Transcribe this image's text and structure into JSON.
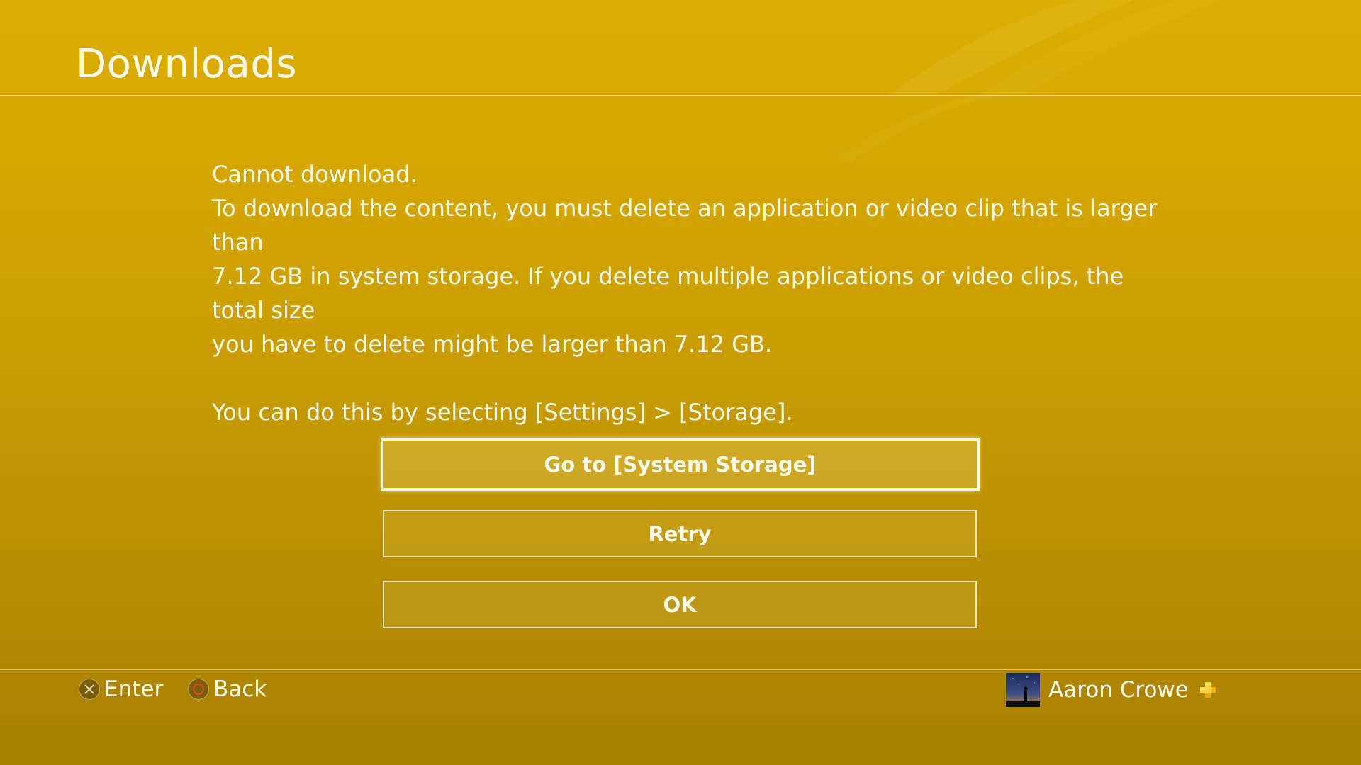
{
  "header": {
    "title": "Downloads"
  },
  "message": {
    "lines": [
      "Cannot download.",
      "To download the content, you must delete an application or video clip that is larger than",
      "7.12 GB in system storage. If you delete multiple applications or video clips, the total size",
      "you have to delete might be larger than 7.12 GB.",
      "You can do this by selecting [Settings] > [Storage]."
    ]
  },
  "buttons": {
    "storage_label": "Go to [System Storage]",
    "retry_label": "Retry",
    "ok_label": "OK",
    "focused": "storage"
  },
  "footer": {
    "enter_label": "Enter",
    "enter_icon": "cross-button-icon",
    "back_label": "Back",
    "back_icon": "circle-button-icon"
  },
  "user": {
    "name": "Aaron Crowe",
    "avatar_icon": "avatar",
    "plus_icon": "playstation-plus-icon"
  },
  "colors": {
    "background_top": "#dcae03",
    "background_bottom": "#a77f02",
    "text": "#fffbea",
    "plus": "#ffd24a"
  }
}
